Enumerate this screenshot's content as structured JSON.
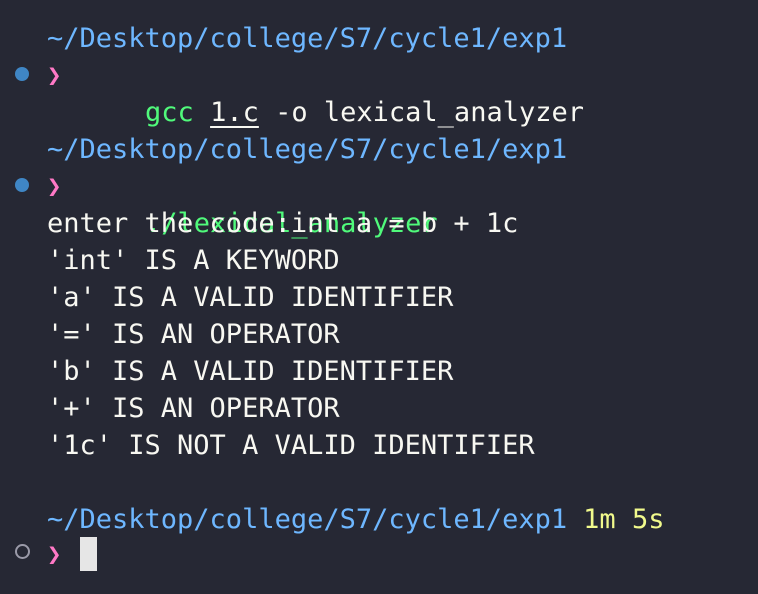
{
  "blocks": [
    {
      "path": "~/Desktop/college/S7/cycle1/exp1",
      "prompt": "❯",
      "command_prog": "gcc",
      "command_file": "1.c",
      "command_rest": "-o lexical_analyzer"
    },
    {
      "path": "~/Desktop/college/S7/cycle1/exp1",
      "prompt": "❯",
      "command_prog": "./lexical_analyzer",
      "output": [
        "enter the code:int a = b + 1c",
        "'int' IS A KEYWORD",
        "'a' IS A VALID IDENTIFIER",
        "'=' IS AN OPERATOR",
        "'b' IS A VALID IDENTIFIER",
        "'+' IS AN OPERATOR",
        "'1c' IS NOT A VALID IDENTIFIER"
      ]
    },
    {
      "path": "~/Desktop/college/S7/cycle1/exp1",
      "duration": "1m 5s",
      "prompt": "❯"
    }
  ],
  "colors": {
    "background": "#262834",
    "path": "#6eb7ff",
    "prompt": "#ff79c6",
    "command": "#50fa7b",
    "duration": "#f1fa8c",
    "status_dot": "#3f86c5"
  },
  "icons": {
    "status_done": "filled-circle-icon",
    "status_idle": "hollow-circle-icon",
    "prompt": "chevron-right-icon",
    "cursor": "block-cursor-icon"
  }
}
